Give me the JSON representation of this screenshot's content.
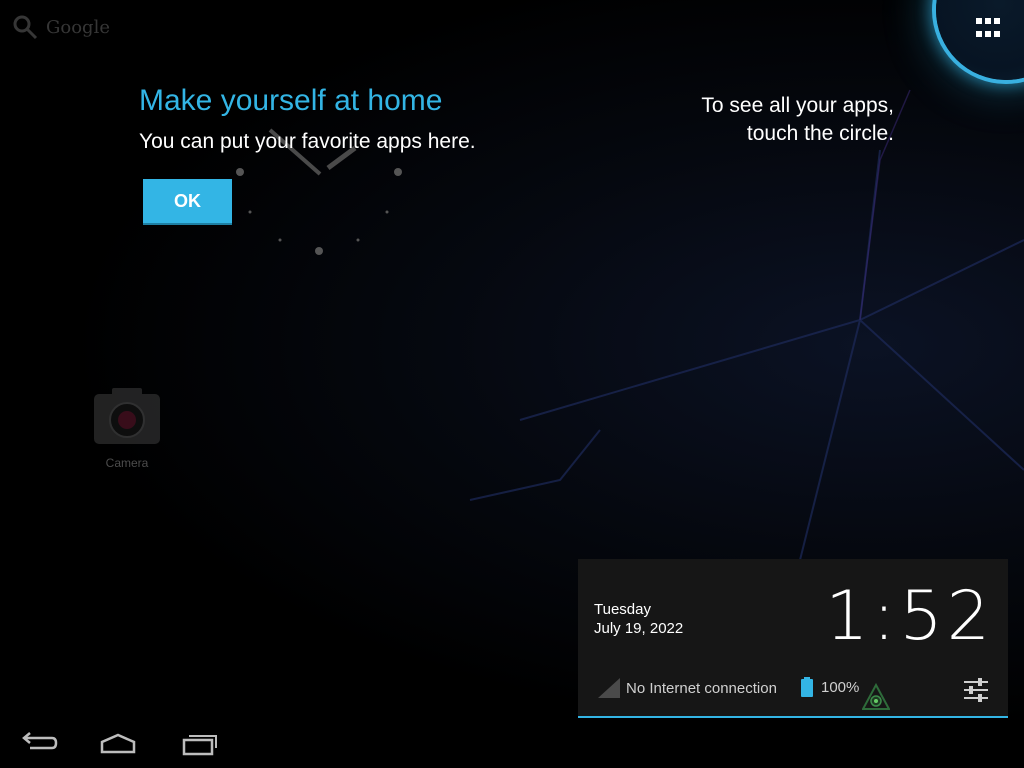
{
  "search": {
    "label": "Google",
    "icon": "search-icon"
  },
  "cling": {
    "title": "Make yourself at home",
    "body": "You can put your favorite apps here.",
    "ok_label": "OK",
    "apps_hint": "To see all your apps, touch the circle."
  },
  "all_apps": {
    "icon": "grid-icon"
  },
  "desktop": {
    "camera_label": "Camera"
  },
  "notification_panel": {
    "day": "Tuesday",
    "date": "July 19, 2022",
    "time": "1:52",
    "network_status": "No Internet connection",
    "battery_level": "100%"
  },
  "nav": {
    "back_icon": "back-icon",
    "home_icon": "home-icon",
    "recents_icon": "recent-apps-icon"
  },
  "colors": {
    "accent": "#33b5e5",
    "panel_bg": "#161616"
  }
}
